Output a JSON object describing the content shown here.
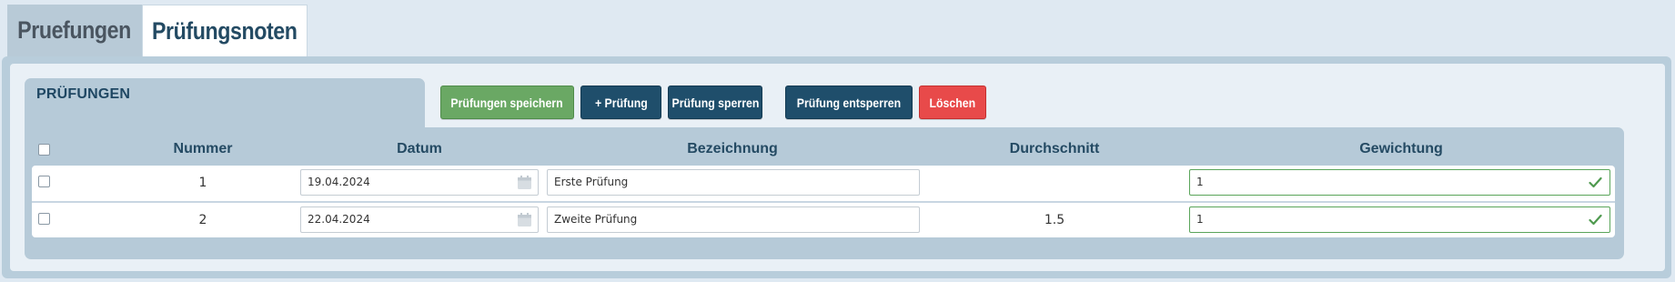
{
  "tabs": [
    {
      "label": "Pruefungen",
      "active": false
    },
    {
      "label": "Prüfungsnoten",
      "active": true
    }
  ],
  "panel": {
    "title": "PRÜFUNGEN"
  },
  "toolbar": {
    "save_label": "Prüfungen speichern",
    "add_label": "+ Prüfung",
    "lock_label": "Prüfung sperren",
    "unlock_label": "Prüfung entsperren",
    "delete_label": "Löschen"
  },
  "table": {
    "headers": {
      "nummer": "Nummer",
      "datum": "Datum",
      "bezeichnung": "Bezeichnung",
      "durchschnitt": "Durchschnitt",
      "gewichtung": "Gewichtung"
    },
    "rows": [
      {
        "nummer": "1",
        "datum": "19.04.2024",
        "bezeichnung": "Erste Prüfung",
        "durchschnitt": "",
        "gewichtung": "1"
      },
      {
        "nummer": "2",
        "datum": "22.04.2024",
        "bezeichnung": "Zweite Prüfung",
        "durchschnitt": "1.5",
        "gewichtung": "1"
      }
    ]
  },
  "icons": {
    "date": "calendar-icon",
    "valid": "checkmark-icon"
  },
  "colors": {
    "save": "#6aa864",
    "primary": "#1f4e6b",
    "danger": "#e84a4a",
    "valid": "#5aa55a"
  }
}
